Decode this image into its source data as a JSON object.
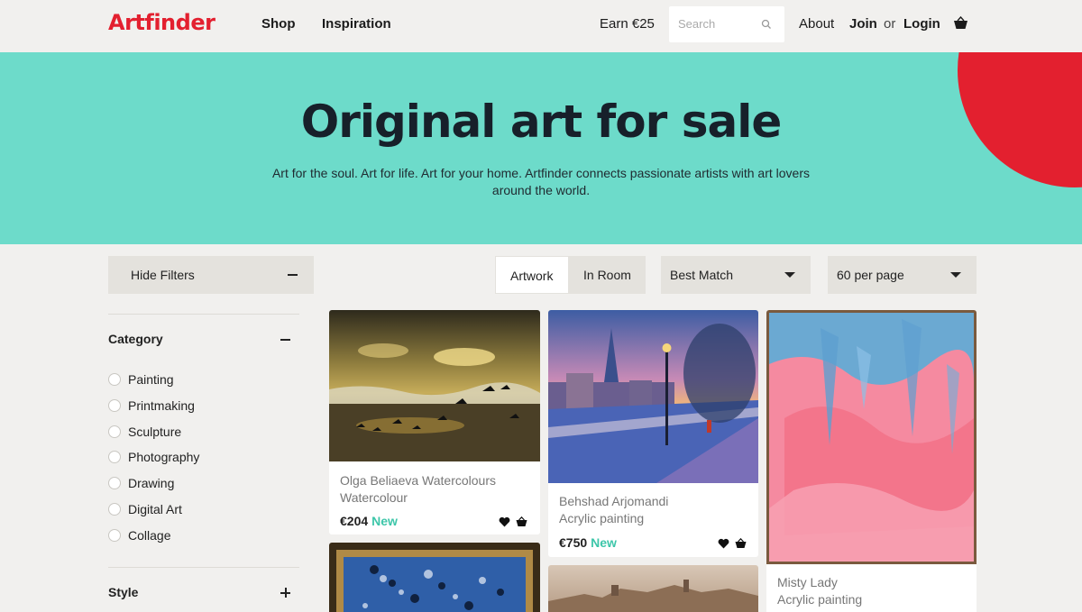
{
  "header": {
    "logo": "Artfinder",
    "nav": [
      "Shop",
      "Inspiration"
    ],
    "earn": "Earn €25",
    "search_placeholder": "Search",
    "about": "About",
    "join": "Join",
    "or": "or",
    "login": "Login"
  },
  "hero": {
    "title": "Original art for sale",
    "subtitle": "Art for the soul. Art for life. Art for your home. Artfinder connects passionate artists with art lovers around the world."
  },
  "filters": {
    "hide_label": "Hide Filters",
    "view_tabs": [
      "Artwork",
      "In Room"
    ],
    "active_tab": "Artwork",
    "sort_value": "Best Match",
    "per_page_value": "60 per page",
    "category_title": "Category",
    "categories": [
      "Painting",
      "Printmaking",
      "Sculpture",
      "Photography",
      "Drawing",
      "Digital Art",
      "Collage"
    ],
    "style_title": "Style"
  },
  "artworks": [
    {
      "artist": "Olga Beliaeva Watercolours",
      "medium": "Watercolour",
      "price": "€204",
      "badge": "New"
    },
    {
      "artist": "Behshad Arjomandi",
      "medium": "Acrylic painting",
      "price": "€750",
      "badge": "New"
    },
    {
      "artist": "Misty Lady",
      "medium": "Acrylic painting"
    }
  ],
  "colors": {
    "brand_red": "#e3202f",
    "hero_teal": "#6ddbca",
    "new_badge": "#3dc6a9"
  }
}
